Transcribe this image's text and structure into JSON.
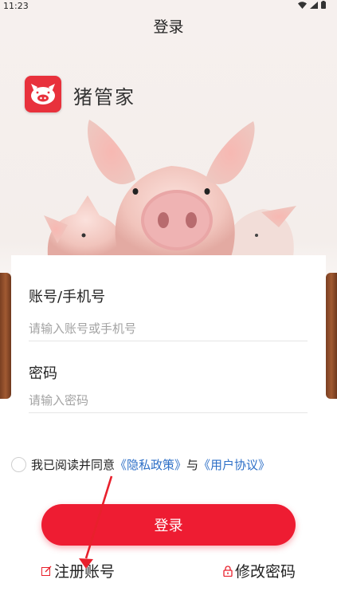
{
  "status_bar": {
    "time": "11:23",
    "icons": [
      "wifi-icon",
      "signal-icon",
      "battery-icon"
    ]
  },
  "nav": {
    "title": "登录"
  },
  "brand": {
    "app_name": "猪管家"
  },
  "form": {
    "account_label": "账号/手机号",
    "account_placeholder": "请输入账号或手机号",
    "password_label": "密码",
    "password_placeholder": "请输入密码"
  },
  "agreement": {
    "prefix": "我已阅读并同意",
    "privacy_link": "《隐私政策》",
    "conjunction": "与",
    "terms_link": "《用户协议》"
  },
  "login_button": {
    "label": "登录"
  },
  "links": {
    "register": "注册账号",
    "change_password": "修改密码"
  },
  "colors": {
    "primary": "#ee1c32",
    "link": "#2d6fc7",
    "annotation_arrow": "#e8202c"
  }
}
